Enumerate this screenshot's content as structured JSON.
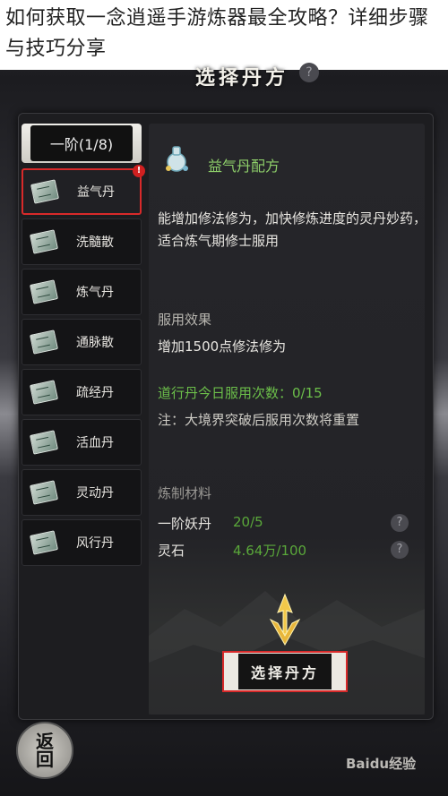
{
  "caption": {
    "text": "如何获取一念逍遥手游炼器最全攻略？详细步骤与技巧分享"
  },
  "header": {
    "title": "选择丹方",
    "help_label": "?"
  },
  "sidebar": {
    "tier_label": "一阶(1/8)",
    "alert_label": "!",
    "items": [
      {
        "label": "益气丹"
      },
      {
        "label": "洗髓散"
      },
      {
        "label": "炼气丹"
      },
      {
        "label": "通脉散"
      },
      {
        "label": "疏经丹"
      },
      {
        "label": "活血丹"
      },
      {
        "label": "灵动丹"
      },
      {
        "label": "风行丹"
      }
    ]
  },
  "detail": {
    "title": "益气丹配方",
    "description": "能增加修法修为，加快修炼进度的灵丹妙药，适合炼气期修士服用",
    "effect_heading": "服用效果",
    "effect": "增加1500点修法修为",
    "daily_uses": "道行丹今日服用次数：0/15",
    "note": "注：大境界突破后服用次数将重置",
    "materials_heading": "炼制材料",
    "materials": [
      {
        "name": "一阶妖丹",
        "amount": "20/5",
        "help": "?"
      },
      {
        "name": "灵石",
        "amount": "4.64万/100",
        "help": "?"
      }
    ]
  },
  "actions": {
    "choose_label": "选择丹方",
    "back_label": "返回"
  },
  "watermark": {
    "text": "Baidu经验"
  },
  "colors": {
    "highlight_red": "#d82a2a",
    "title_green": "#8ecf6a",
    "value_green": "#5aa83a"
  }
}
